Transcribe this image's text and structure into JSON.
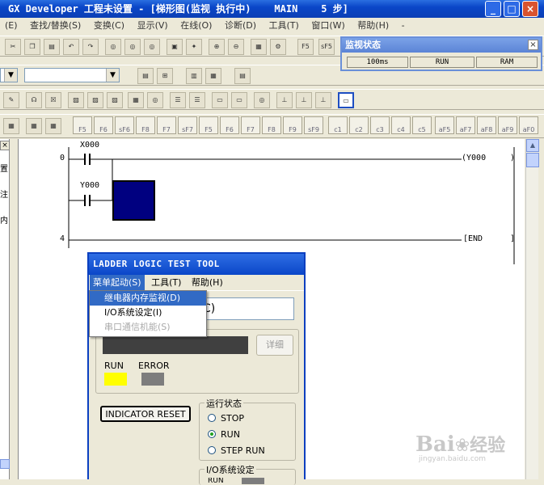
{
  "window": {
    "title": "GX Developer 工程未设置 - [梯形图(监视 执行中)    MAIN    5 步]",
    "min": "_",
    "max": "□",
    "close": "×"
  },
  "menubar": {
    "items": [
      "(E)",
      "查找/替换(S)",
      "变换(C)",
      "显示(V)",
      "在线(O)",
      "诊断(D)",
      "工具(T)",
      "窗口(W)",
      "帮助(H)",
      "-"
    ]
  },
  "toolbar": {
    "f5": "F5",
    "sf5": "sF5",
    "fkeys": [
      "F5",
      "F6",
      "sF6",
      "F8",
      "F7",
      "sF7",
      "F5",
      "F6",
      "F7",
      "F8",
      "F9",
      "sF9",
      "c1",
      "c2",
      "c3",
      "c4",
      "c5",
      "aF5",
      "aF7",
      "aF8",
      "aF9",
      "aF0"
    ]
  },
  "monitor": {
    "title": "监视状态",
    "close": "×",
    "scan_time": "100ms",
    "state": "RUN",
    "memory": "RAM"
  },
  "ladder": {
    "step0": "0",
    "step4": "4",
    "x000": "X000",
    "y000_contact": "Y000",
    "y000_coil": "(Y000",
    "coil_end": ")",
    "end": "[END",
    "end_bracket": "]",
    "colors": {
      "active_contact": "#000080"
    }
  },
  "leftpanel": {
    "close": "×",
    "chars": [
      "置",
      "注",
      "内"
    ]
  },
  "dialog": {
    "title": "LADDER LOGIC TEST TOOL",
    "menu": [
      "菜单起动(S)",
      "工具(T)",
      "帮助(H)"
    ],
    "plc_text": "C)",
    "detail_button": "详细",
    "run_label": "RUN",
    "error_label": "ERROR",
    "indicator_reset": "INDICATOR RESET",
    "run_state_group": "运行状态",
    "radio_stop": "STOP",
    "radio_run": "RUN",
    "radio_step_run": "STEP RUN",
    "io_group": "I/O系统设定",
    "io_value": "RUN",
    "colors": {
      "run_led": "#ffff00",
      "error_led": "#7d7d7d",
      "status_bar": "#404040"
    }
  },
  "dropdown": {
    "items": [
      "继电器内存监视(D)",
      "I/O系统设定(I)",
      "串口通信机能(S)"
    ]
  },
  "watermark": {
    "brand": "Bai",
    "brand_tail": "经验",
    "url": "jingyan.baidu.com"
  }
}
